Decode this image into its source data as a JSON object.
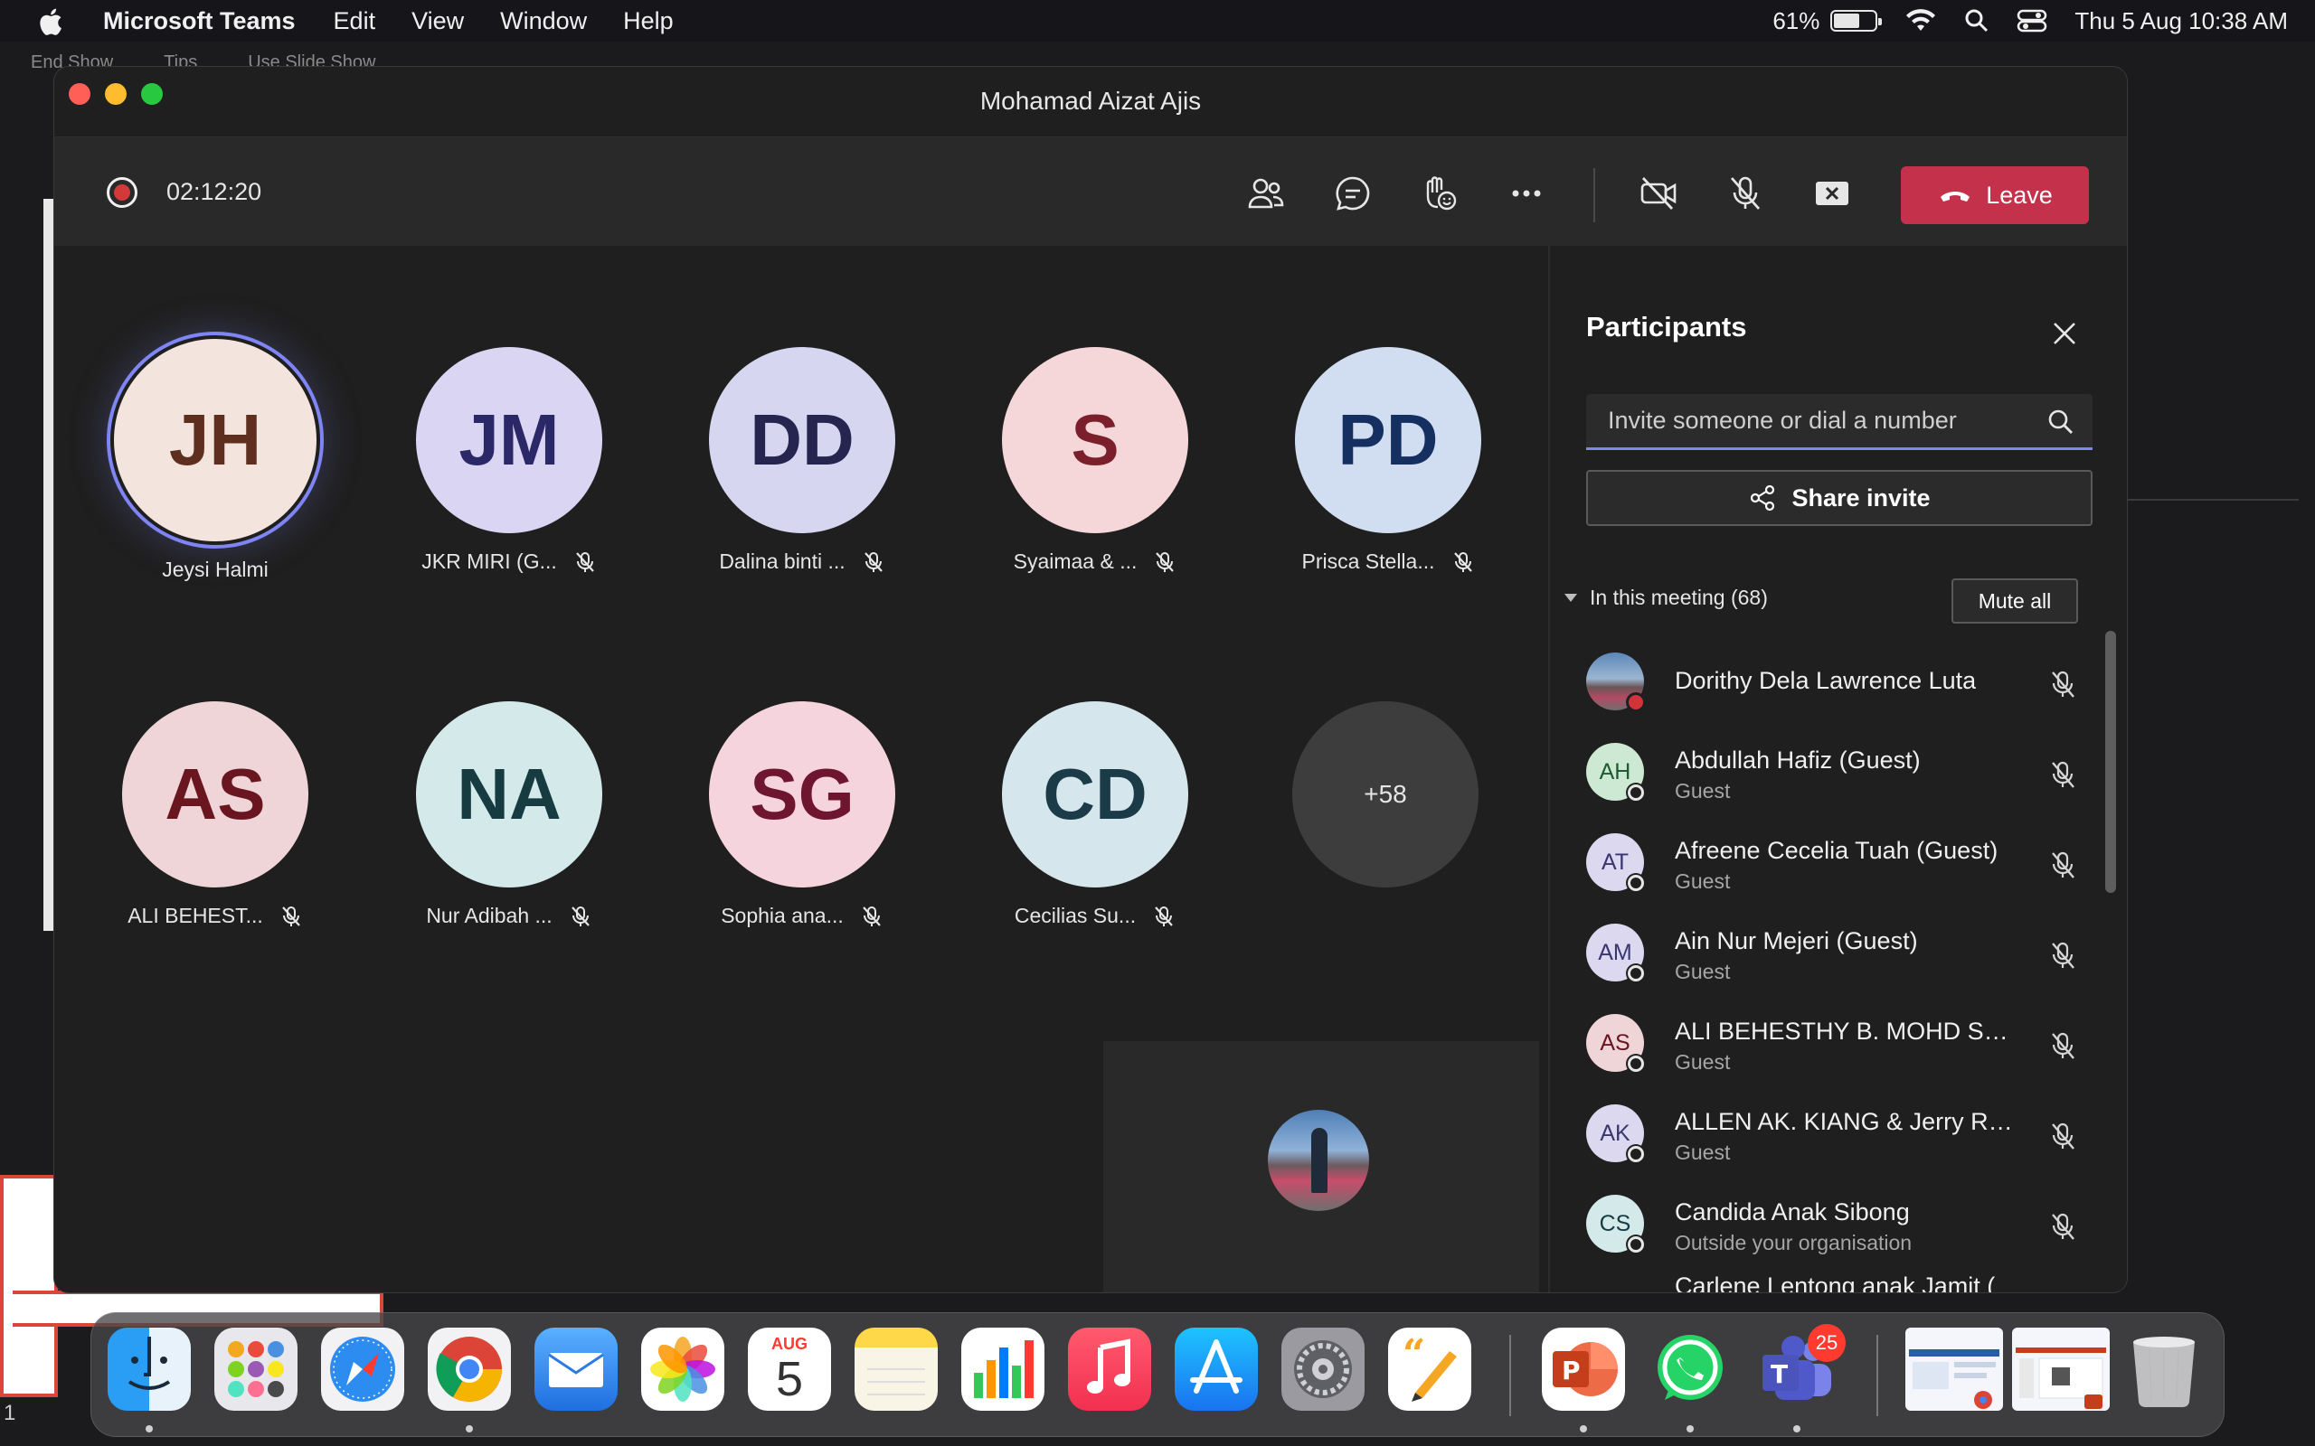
{
  "menubar": {
    "app_name": "Microsoft Teams",
    "menus": [
      "Edit",
      "View",
      "Window",
      "Help"
    ],
    "battery": "61%",
    "datetime": "Thu 5 Aug  10:38 AM"
  },
  "background_app": {
    "toolbar": [
      "End Show",
      "Tips",
      "Use Slide Show"
    ],
    "slide_number": "1"
  },
  "window": {
    "title": "Mohamad Aizat Ajis"
  },
  "meeting_toolbar": {
    "timer": "02:12:20",
    "leave_label": "Leave",
    "icons": [
      "participants-icon",
      "chat-icon",
      "reactions-icon",
      "more-icon",
      "camera-off-icon",
      "mic-off-icon",
      "share-screen-icon",
      "phone-hangup-icon"
    ]
  },
  "tiles": [
    {
      "initials": "JH",
      "name": "Jeysi Halmi",
      "bg": "#f4e4de",
      "fg": "#5e2f1f",
      "muted": false,
      "active": true
    },
    {
      "initials": "JM",
      "name": "JKR MIRI (G...",
      "bg": "#d9d5f3",
      "fg": "#2b2868",
      "muted": true
    },
    {
      "initials": "DD",
      "name": "Dalina binti ...",
      "bg": "#d6d6f0",
      "fg": "#25254f",
      "muted": true
    },
    {
      "initials": "S",
      "name": "Syaimaa & ...",
      "bg": "#f5d6d9",
      "fg": "#7a1f2b",
      "muted": true
    },
    {
      "initials": "PD",
      "name": "Prisca Stella...",
      "bg": "#d1ddf0",
      "fg": "#153060",
      "muted": true
    },
    {
      "initials": "AS",
      "name": "ALI BEHEST...",
      "bg": "#f0d5d8",
      "fg": "#6a1620",
      "muted": true
    },
    {
      "initials": "NA",
      "name": "Nur Adibah ...",
      "bg": "#d4e9ea",
      "fg": "#163c42",
      "muted": true
    },
    {
      "initials": "SG",
      "name": "Sophia ana...",
      "bg": "#f6d4de",
      "fg": "#6e1530",
      "muted": true
    },
    {
      "initials": "CD",
      "name": "Cecilias Su...",
      "bg": "#d5e6ec",
      "fg": "#1a3b47",
      "muted": true
    }
  ],
  "overflow_count": "+58",
  "participants_panel": {
    "title": "Participants",
    "search_placeholder": "Invite someone or dial a number",
    "share_invite": "Share invite",
    "section_label": "In this meeting (68)",
    "mute_all": "Mute all",
    "people": [
      {
        "initials": "",
        "name": "Dorithy Dela Lawrence Luta",
        "sub": "",
        "photo": true,
        "bg": "#5c86b8",
        "fg": "#ffffff"
      },
      {
        "initials": "AH",
        "name": "Abdullah Hafiz (Guest)",
        "sub": "Guest",
        "bg": "#cde9d4",
        "fg": "#1f5a30"
      },
      {
        "initials": "AT",
        "name": "Afreene Cecelia Tuah (Guest)",
        "sub": "Guest",
        "bg": "#dcd8ef",
        "fg": "#3a3670"
      },
      {
        "initials": "AM",
        "name": "Ain Nur Mejeri (Guest)",
        "sub": "Guest",
        "bg": "#dcd8ef",
        "fg": "#3a3670"
      },
      {
        "initials": "AS",
        "name": "ALI BEHESTHY B. MOHD SUP...",
        "sub": "Guest",
        "bg": "#f0d5d8",
        "fg": "#6a1620"
      },
      {
        "initials": "AK",
        "name": "ALLEN AK. KIANG & Jerry Ro...",
        "sub": "Guest",
        "bg": "#dcd8ef",
        "fg": "#3a3670"
      },
      {
        "initials": "CS",
        "name": "Candida Anak Sibong",
        "sub": "Outside your organisation",
        "bg": "#d4e9ea",
        "fg": "#163c42"
      }
    ],
    "partial_next": "Carlene Lentong anak Jamit ("
  },
  "dock": {
    "calendar_month": "AUG",
    "calendar_day": "5",
    "teams_badge": "25",
    "apps": [
      "finder-icon",
      "launchpad-icon",
      "safari-icon",
      "chrome-icon",
      "mail-icon",
      "photos-icon",
      "calendar-icon",
      "notes-icon",
      "numbers-icon",
      "music-icon",
      "app-store-icon",
      "system-preferences-icon",
      "pages-icon",
      "powerpoint-icon",
      "whatsapp-icon",
      "teams-icon",
      "window-thumbnail-chrome",
      "window-thumbnail-powerpoint",
      "trash-icon"
    ]
  }
}
